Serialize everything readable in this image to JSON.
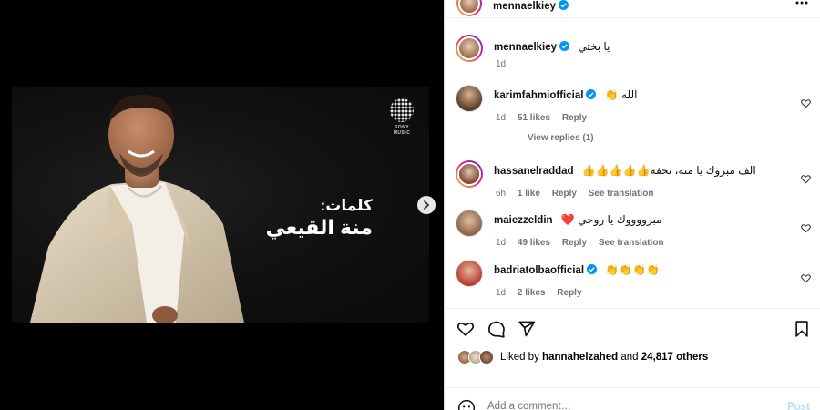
{
  "media": {
    "brand_logo_text": "SONY MUSIC",
    "lyrics_label": "كلمات:",
    "lyrics_name": "منة القيعي",
    "carousel_count": 4,
    "carousel_active_index": 0
  },
  "post": {
    "author": "mennaelkiey",
    "caption": {
      "username": "mennaelkiey",
      "text": "يا بختي",
      "time": "1d"
    }
  },
  "comments": [
    {
      "username": "karimfahmiofficial",
      "verified": true,
      "text": "الله 👏",
      "time": "1d",
      "likes": "51 likes",
      "reply": "Reply",
      "translation": ""
    },
    {
      "username": "hassanelraddad",
      "verified": false,
      "text": "الف مبروك يا منه، تحفه👍👍👍👍👍",
      "time": "6h",
      "likes": "1 like",
      "reply": "Reply",
      "translation": "See translation"
    },
    {
      "username": "maiezzeldin",
      "verified": false,
      "text": "مبرووووك يا روحي ❤️",
      "time": "1d",
      "likes": "49 likes",
      "reply": "Reply",
      "translation": "See translation"
    },
    {
      "username": "badriatolbaofficial",
      "verified": true,
      "text": "👏👏👏👏",
      "time": "1d",
      "likes": "2 likes",
      "reply": "Reply",
      "translation": ""
    }
  ],
  "view_replies": "View replies (1)",
  "likes": {
    "prefix": "Liked by",
    "user": "hannahelzahed",
    "middle": "and",
    "count": "24,817 others"
  },
  "comment_box": {
    "placeholder": "Add a comment…",
    "post_label": "Post"
  },
  "colors": {
    "verified": "#0095f6",
    "heart_red": "#ed4956",
    "post_disabled": "#b2dffc"
  }
}
